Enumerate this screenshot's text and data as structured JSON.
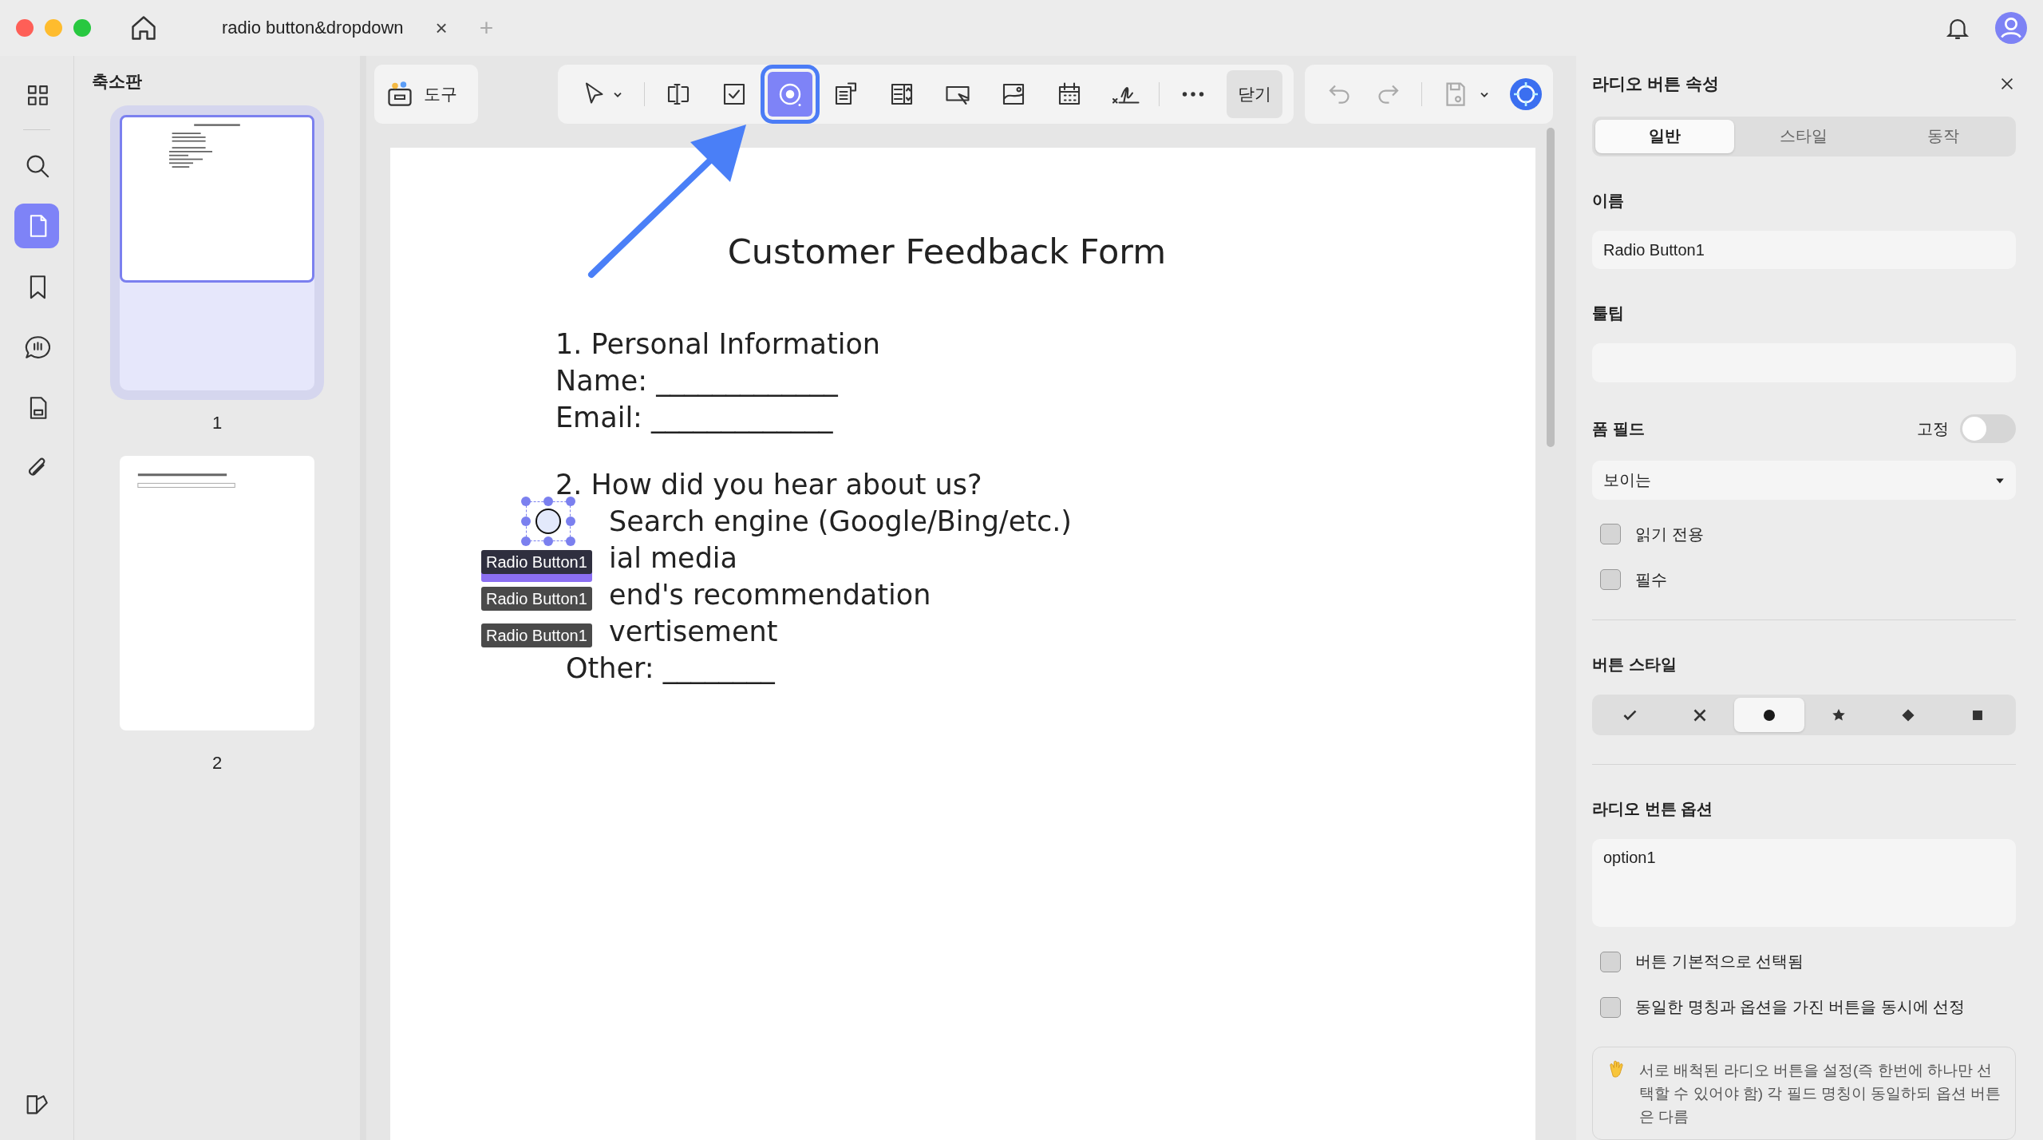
{
  "window": {
    "tab_title": "radio button&dropdown",
    "tab_close": "×",
    "new_tab": "+"
  },
  "rail": [
    {
      "kind": "apps",
      "selected": false
    },
    {
      "kind": "search",
      "selected": false
    },
    {
      "kind": "pages",
      "selected": true
    },
    {
      "kind": "bookmark",
      "selected": false
    },
    {
      "kind": "comment",
      "selected": false
    },
    {
      "kind": "form",
      "selected": false
    },
    {
      "kind": "attachment",
      "selected": false
    }
  ],
  "thumbnails": {
    "title": "축소판",
    "pages": [
      {
        "number": "1",
        "selected": true
      },
      {
        "number": "2",
        "selected": false
      }
    ]
  },
  "tools_button": {
    "label": "도구"
  },
  "toolbar": [
    {
      "kind": "select",
      "selected": false
    },
    {
      "kind": "text-field",
      "selected": false
    },
    {
      "kind": "checkbox",
      "selected": false
    },
    {
      "kind": "radio",
      "selected": true
    },
    {
      "kind": "combo",
      "selected": false
    },
    {
      "kind": "list",
      "selected": false
    },
    {
      "kind": "button",
      "selected": false
    },
    {
      "kind": "image",
      "selected": false
    },
    {
      "kind": "date",
      "selected": false
    },
    {
      "kind": "signature",
      "selected": false
    },
    {
      "kind": "more",
      "selected": false
    },
    {
      "kind": "close",
      "label": "닫기",
      "selected": false
    }
  ],
  "document": {
    "title": "Customer Feedback Form",
    "section_1": "1. Personal Information",
    "name_line": "Name: _____________",
    "email_line": "Email: _____________",
    "question": "2. How did you hear about us?",
    "options": [
      {
        "text": "Search engine (Google/Bing/etc.)"
      },
      {
        "tag": "Radio Button1",
        "text": "ial media"
      },
      {
        "tag": "Radio Button1",
        "text": "end's recommendation"
      },
      {
        "tag": "Radio Button1",
        "text": "vertisement"
      }
    ],
    "other_line": "Other: ________"
  },
  "properties": {
    "title": "라디오 버튼 속성",
    "tabs": [
      {
        "label": "일반",
        "selected": true
      },
      {
        "label": "스타일",
        "selected": false
      },
      {
        "label": "동작",
        "selected": false
      }
    ],
    "name_label": "이름",
    "name_value": "Radio Button1",
    "tooltip_label": "툴팁",
    "form_field_label": "폼 필드",
    "lock_label": "고정",
    "lock_on": false,
    "visibility": "보이는",
    "field_checks": [
      {
        "label": "읽기 전용",
        "checked": false
      },
      {
        "label": "필수",
        "checked": false
      }
    ],
    "style_label": "버튼 스타일",
    "styles": [
      {
        "kind": "check",
        "selected": false
      },
      {
        "kind": "cross",
        "selected": false
      },
      {
        "kind": "circle",
        "selected": true
      },
      {
        "kind": "star",
        "selected": false
      },
      {
        "kind": "diamond",
        "selected": false
      },
      {
        "kind": "square",
        "selected": false
      }
    ],
    "options_label": "라디오 번튼 옵션",
    "option_value": "option1",
    "option_checks": [
      {
        "label": "버튼 기본적으로 선택됨",
        "checked": false
      },
      {
        "label": "동일한 명칭과 옵션을 가진 버튼을 동시에 선정",
        "checked": false
      }
    ],
    "note": "서로 배척된 라디오 버튼을 설정(즉 한번에 하나만 선택할 수 있어야 함) 각 필드 명칭이  동일하되 옵션 버튼은 다름"
  }
}
